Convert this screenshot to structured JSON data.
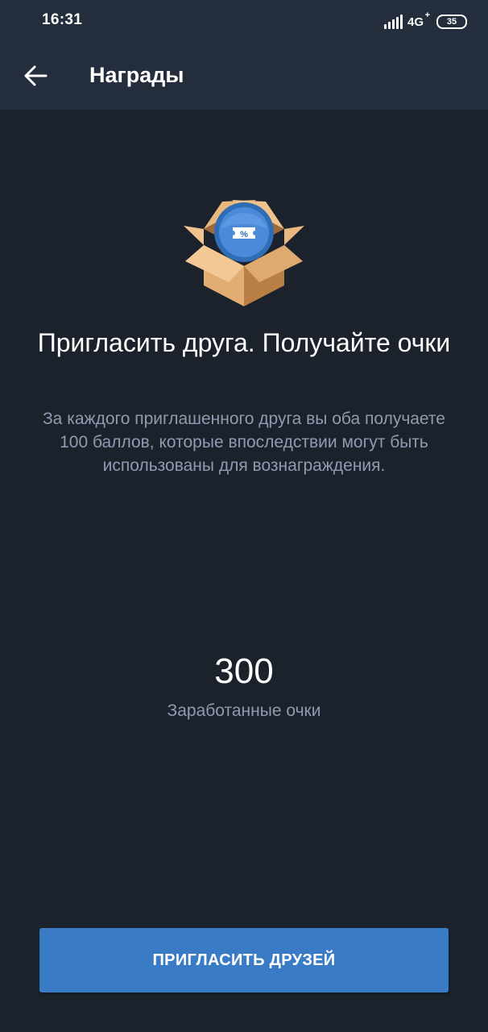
{
  "status_bar": {
    "time": "16:31",
    "network": "4G",
    "network_plus": "+",
    "battery": "35"
  },
  "app_bar": {
    "back_icon": "arrow-left-icon",
    "title": "Награды"
  },
  "promo": {
    "illustration_icon": "gift-box-coupon-icon",
    "headline": "Пригласить друга. Получайте очки",
    "description": "За каждого приглашенного друга вы оба получаете 100 баллов, которые впоследствии могут быть использованы для вознаграждения."
  },
  "points": {
    "value": "300",
    "caption": "Заработанные очки"
  },
  "invite_button": {
    "label": "ПРИГЛАСИТЬ ДРУЗЕЙ"
  },
  "colors": {
    "background": "#1c222c",
    "app_bar": "#232d3b",
    "accent_button": "#3a7bc6",
    "secondary_text": "#8e9bb0"
  }
}
